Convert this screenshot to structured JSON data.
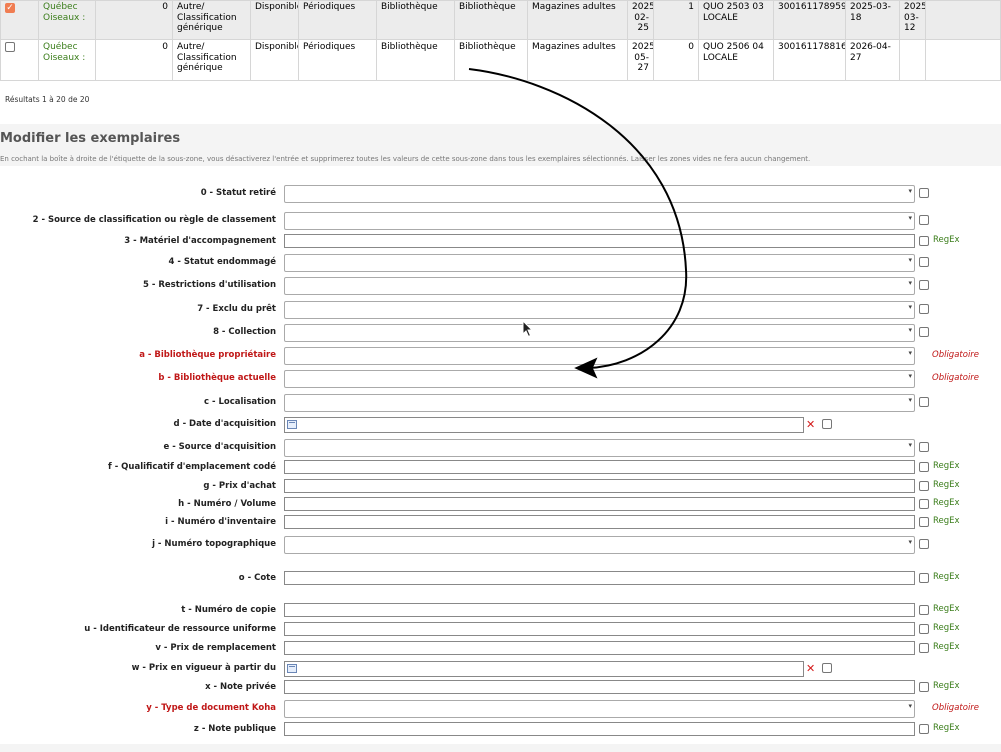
{
  "table": {
    "rows": [
      {
        "checked": true,
        "cells": [
          "Québec Oiseaux :",
          "0",
          "Autre/ Classification générique",
          "Disponible",
          "Périodiques",
          "Bibliothèque",
          "Bibliothèque",
          "Magazines adultes",
          "2025-02-25",
          "1",
          "QUO 2503 03 LOCALE",
          "30016117895961",
          "2025-03-18",
          "2025-03-12",
          ""
        ]
      },
      {
        "checked": false,
        "cells": [
          "Québec Oiseaux :",
          "0",
          "Autre/ Classification générique",
          "Disponible",
          "Périodiques",
          "Bibliothèque",
          "Bibliothèque",
          "Magazines adultes",
          "2025-05-27",
          "0",
          "QUO 2506 04 LOCALE",
          "30016117881656",
          "2026-04-27",
          "",
          ""
        ]
      }
    ],
    "results_text": "Résultats 1 à 20 de 20"
  },
  "modify": {
    "title": "Modifier les exemplaires",
    "hint": "En cochant la boîte à droite de l'étiquette de la sous-zone, vous désactiverez l'entrée et supprimerez toutes les valeurs de cette sous-zone dans tous les exemplaires sélectionnés. Laisser les zones vides ne fera aucun changement.",
    "regex_label": "RegEx",
    "required_label": "Obligatoire",
    "fields": [
      {
        "label": "0 - Statut retiré",
        "type": "select",
        "required": false,
        "regex": false
      },
      {
        "label": "2 - Source de classification ou règle de classement",
        "type": "select",
        "required": false,
        "regex": false
      },
      {
        "label": "3 - Matériel d'accompagnement",
        "type": "text",
        "required": false,
        "regex": true
      },
      {
        "label": "4 - Statut endommagé",
        "type": "select",
        "required": false,
        "regex": false
      },
      {
        "label": "5 - Restrictions d'utilisation",
        "type": "select",
        "required": false,
        "regex": false
      },
      {
        "label": "7 - Exclu du prêt",
        "type": "select",
        "required": false,
        "regex": false
      },
      {
        "label": "8 - Collection",
        "type": "select",
        "required": false,
        "regex": false
      },
      {
        "label": "a - Bibliothèque propriétaire",
        "type": "select",
        "required": true,
        "regex": false
      },
      {
        "label": "b - Bibliothèque actuelle",
        "type": "select",
        "required": true,
        "regex": false
      },
      {
        "label": "c - Localisation",
        "type": "select",
        "required": false,
        "regex": false
      },
      {
        "label": "d - Date d'acquisition",
        "type": "date",
        "required": false,
        "regex": false
      },
      {
        "label": "e - Source d'acquisition",
        "type": "select",
        "required": false,
        "regex": false
      },
      {
        "label": "f - Qualificatif d'emplacement codé",
        "type": "text",
        "required": false,
        "regex": true
      },
      {
        "label": "g - Prix d'achat",
        "type": "text",
        "required": false,
        "regex": true
      },
      {
        "label": "h - Numéro / Volume",
        "type": "text",
        "required": false,
        "regex": true
      },
      {
        "label": "i - Numéro d'inventaire",
        "type": "text",
        "required": false,
        "regex": true
      },
      {
        "label": "j - Numéro topographique",
        "type": "select",
        "required": false,
        "regex": false
      },
      {
        "label": "o - Cote",
        "type": "text",
        "required": false,
        "regex": true
      },
      {
        "label": "t - Numéro de copie",
        "type": "text",
        "required": false,
        "regex": true
      },
      {
        "label": "u - Identificateur de ressource uniforme",
        "type": "text",
        "required": false,
        "regex": true
      },
      {
        "label": "v - Prix de remplacement",
        "type": "text",
        "required": false,
        "regex": true
      },
      {
        "label": "w - Prix en vigueur à partir du",
        "type": "date",
        "required": false,
        "regex": false
      },
      {
        "label": "x - Note privée",
        "type": "text",
        "required": false,
        "regex": true
      },
      {
        "label": "y - Type de document Koha",
        "type": "select",
        "required": true,
        "regex": false
      },
      {
        "label": "z - Note publique",
        "type": "text",
        "required": false,
        "regex": true
      }
    ]
  },
  "colors": {
    "required": "#c01818",
    "regex": "#3a7d1a",
    "checked_box": "#f07d52",
    "clear": "#d41b1b"
  },
  "icons": [
    "checkbox-icon",
    "calendar-icon",
    "clear-date-icon",
    "dropdown-arrow-icon",
    "mouse-cursor-icon",
    "curved-arrow-annotation"
  ]
}
